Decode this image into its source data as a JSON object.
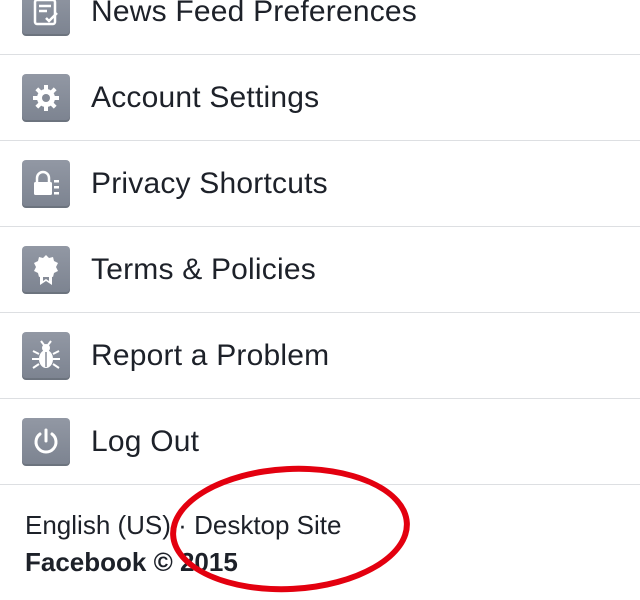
{
  "menu": {
    "items": [
      {
        "label": "News Feed Preferences",
        "icon": "news-feed-icon"
      },
      {
        "label": "Account Settings",
        "icon": "gear-icon"
      },
      {
        "label": "Privacy Shortcuts",
        "icon": "privacy-lock-icon"
      },
      {
        "label": "Terms & Policies",
        "icon": "badge-ribbon-icon"
      },
      {
        "label": "Report a Problem",
        "icon": "bug-icon"
      },
      {
        "label": "Log Out",
        "icon": "power-icon"
      }
    ]
  },
  "footer": {
    "language": "English (US)",
    "separator": "·",
    "desktop_site": "Desktop Site",
    "copyright": "Facebook © 2015"
  },
  "annotation": {
    "color": "#e3000f"
  }
}
